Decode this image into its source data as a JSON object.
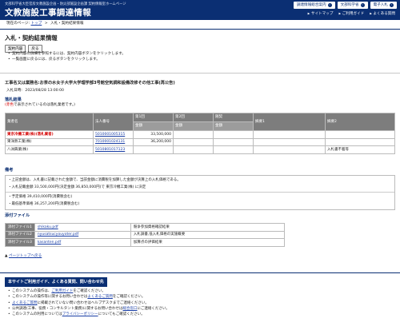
{
  "header": {
    "subtitle": "文部科学省大臣官房文教施設企画・防災部施設企画課 契約情報室ホームページ",
    "title": "文教施設工事調達情報",
    "top_buttons": [
      "調達情報総合案内",
      "文部科学省",
      "電子入札"
    ],
    "links": [
      "サイトマップ",
      "ご利用ガイド",
      "よくある質問"
    ]
  },
  "breadcrumb": {
    "prefix": "現在のページ:",
    "home": "トップ",
    "sep": ">",
    "current": "入札・契約結果情報"
  },
  "page": {
    "heading": "入札・契約結果情報",
    "buttons": [
      "契約内容",
      "戻る"
    ],
    "notes": [
      "契約内容の詳細を参照するには、契約内容ボタンをクリックします。",
      "一覧画面に戻るには、戻るボタンをクリックします。"
    ],
    "project_title": "工事名又は業務名:お茶の水女子大学大学理学部3号館空気調和設備改修その他工事(再公告)",
    "date_label": "入札日時:",
    "date_value": "2023/08/28 13:00:00"
  },
  "results": {
    "section_label": "落札結果",
    "note_red": "(赤色",
    "note_rest": "で表示されているのは落札業者です。)",
    "headers": {
      "company": "業者名",
      "corp_no": "法人番号",
      "round1": "第1回",
      "round2": "第2回",
      "nego": "随契",
      "remark1": "摘要1",
      "remark2": "摘要2",
      "amount": "金額"
    },
    "rows": [
      {
        "company": "東京冷機工業(株)(落札業者)",
        "corp_no": "5010001005315",
        "amount1": "33,500,000",
        "amount2": "",
        "nego": "",
        "remark1": "",
        "remark2": "",
        "winner": true
      },
      {
        "company": "東洋熱工業(株)",
        "corp_no": "7010001024131",
        "amount1": "36,200,000",
        "amount2": "",
        "nego": "",
        "remark1": "",
        "remark2": "",
        "winner": false
      },
      {
        "company": "八洲興業(株)",
        "corp_no": "5010801017123",
        "amount1": "",
        "amount2": "",
        "nego": "",
        "remark1": "",
        "remark2": "入札書不着等",
        "winner": false
      }
    ]
  },
  "remarks": {
    "section_label": "備考",
    "lines": [
      "・上記金額は、入札書に記載された金額で、当該金額に消費税を加算した金額が決算上の入札価格である。",
      "・入札記載金額  33,500,000円(決定金額  36,850,000円)で  東京冷機工業(株)  に決定",
      "・予定価格  39,410,000円(消費税含む)",
      "・最低基準価格  36,257,200円(消費税含む)"
    ]
  },
  "attachments": {
    "section_label": "添付ファイル",
    "rows": [
      {
        "label": "添付ファイル1",
        "file": "shikaku.pdf",
        "desc": "競争参加資格確認結果"
      },
      {
        "label": "添付ファイル2",
        "file": "nyusatsucyouyoter.pdf",
        "desc": "入札調書,低入札価格の実施概要"
      },
      {
        "label": "添付ファイル3",
        "file": "kasanten.pdf",
        "desc": "加算点の評価結果"
      }
    ]
  },
  "back_to_top": "ページトップへ戻る",
  "guide": {
    "title": "本サイトご利用ガイド、よくある質問、問い合わせ先",
    "items": [
      {
        "pre": "このシステムの操作は、",
        "link": "ご利用ガイド",
        "post": "をご確認ください。"
      },
      {
        "pre": "このシステムの操作等に関するお問い合わせは",
        "link": "よくあるご質問",
        "post": "をご確認ください。"
      },
      {
        "pre": "",
        "link": "よくあるご質問",
        "post": "に掲載されていない問い合わせはヘルプデスクまでご連絡ください。"
      },
      {
        "pre": "公共調達(工事、役務・コンサルタント業務)に関するお問い合わせは",
        "link": "総合窓口",
        "post": "にご連絡ください。"
      },
      {
        "pre": "このシステムの利用については",
        "link": "プライバシーポリシー",
        "post": "についてもご確認ください。"
      }
    ]
  }
}
